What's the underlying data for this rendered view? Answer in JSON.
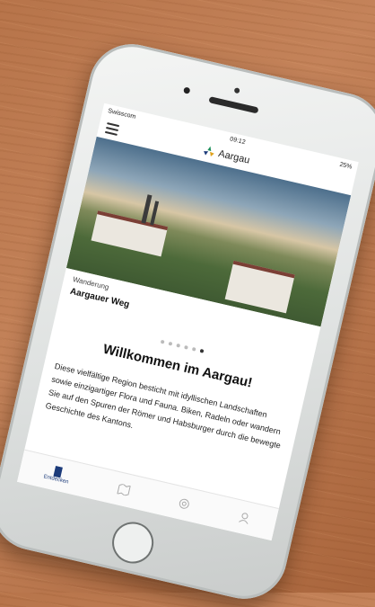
{
  "status_bar": {
    "carrier": "Swisscom",
    "time": "09:12",
    "battery": "25%"
  },
  "nav": {
    "title": "Aargau"
  },
  "hero": {
    "category": "Wanderung",
    "title": "Aargauer Weg"
  },
  "carousel": {
    "dots": 6,
    "active_index": 5
  },
  "welcome": {
    "title": "Willkommen im Aargau!",
    "body": "Diese vielfältige Region besticht mit idyllischen Landschaften sowie einzigartiger Flora und Fauna. Biken, Radeln oder wandern Sie auf den Spuren der Römer und Habsburger durch die bewegte Geschichte des Kantons."
  },
  "tab_bar": {
    "tabs": [
      {
        "label": "Entdecken",
        "icon": "bookmark-icon"
      },
      {
        "label": "",
        "icon": "map-icon"
      },
      {
        "label": "",
        "icon": "target-icon"
      },
      {
        "label": "",
        "icon": "user-icon"
      }
    ]
  },
  "colors": {
    "accent": "#1c3b7a",
    "wood": "#b7744a",
    "phone_body": "#e8eaea"
  }
}
